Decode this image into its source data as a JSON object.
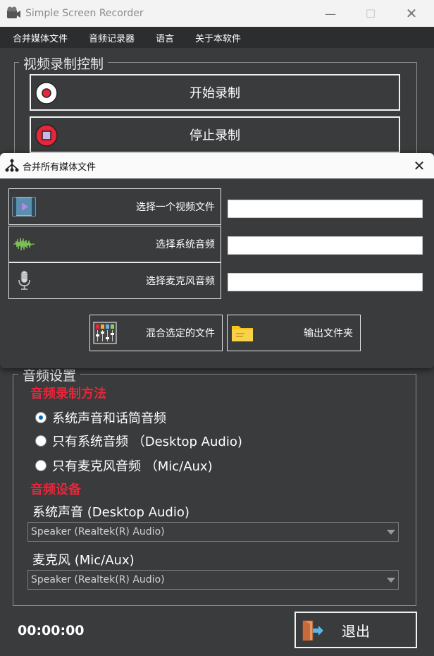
{
  "window": {
    "title": "Simple Screen Recorder",
    "minimize": "—",
    "maximize": "☐",
    "close": "✕"
  },
  "menu": {
    "items": [
      "合并媒体文件",
      "音频记录器",
      "语言",
      "关于本软件"
    ]
  },
  "video_group": {
    "title": "视频录制控制",
    "start_label": "开始录制",
    "stop_label": "停止录制"
  },
  "dialog": {
    "title": "合并所有媒体文件",
    "close": "✕",
    "rows": [
      {
        "label": "选择一个视频文件",
        "icon": "video-file-icon",
        "value": ""
      },
      {
        "label": "选择系统音频",
        "icon": "waveform-icon",
        "value": ""
      },
      {
        "label": "选择麦克风音频",
        "icon": "microphone-icon",
        "value": ""
      }
    ],
    "mix_label": "混合选定的文件",
    "output_label": "输出文件夹"
  },
  "audio_group": {
    "title": "音频设置",
    "method_heading": "音频录制方法",
    "options": [
      {
        "label": "系统声音和话筒音频",
        "checked": true
      },
      {
        "label": "只有系统音频 （Desktop Audio)",
        "checked": false
      },
      {
        "label": "只有麦克风音频 （Mic/Aux)",
        "checked": false
      }
    ],
    "device_heading": "音频设备",
    "system_label": "系统声音 (Desktop Audio)",
    "system_value": "Speaker (Realtek(R) Audio)",
    "mic_label": "麦克风 (Mic/Aux)",
    "mic_value": "Speaker (Realtek(R) Audio)"
  },
  "footer": {
    "timer": "00:00:00",
    "exit_label": "退出"
  },
  "colors": {
    "background": "#3a3b3c",
    "menubar": "#2c2d2e",
    "accent_red": "#e8263a",
    "radio_selected": "#0067c0"
  }
}
